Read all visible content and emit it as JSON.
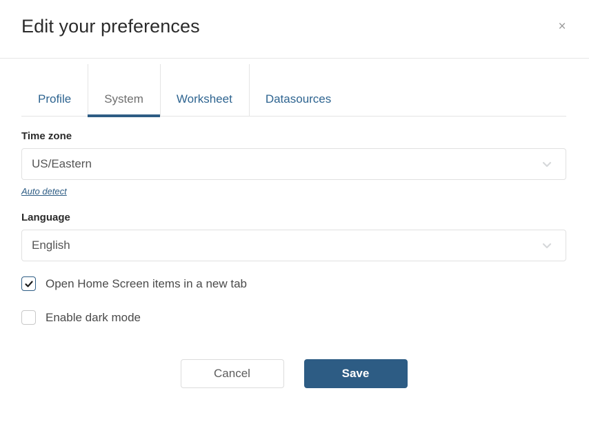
{
  "header": {
    "title": "Edit your preferences",
    "close_label": "×"
  },
  "tabs": [
    {
      "label": "Profile",
      "active": false
    },
    {
      "label": "System",
      "active": true
    },
    {
      "label": "Worksheet",
      "active": false
    },
    {
      "label": "Datasources",
      "active": false
    }
  ],
  "fields": {
    "timezone": {
      "label": "Time zone",
      "value": "US/Eastern",
      "auto_detect_label": "Auto detect"
    },
    "language": {
      "label": "Language",
      "value": "English"
    }
  },
  "checkboxes": [
    {
      "label": "Open Home Screen items in a new tab",
      "checked": true
    },
    {
      "label": "Enable dark mode",
      "checked": false
    }
  ],
  "footer": {
    "cancel_label": "Cancel",
    "save_label": "Save"
  },
  "colors": {
    "accent": "#2d5c84",
    "link": "#2e6490",
    "border": "#e0e0e0",
    "muted_text": "#6f6f6f"
  }
}
